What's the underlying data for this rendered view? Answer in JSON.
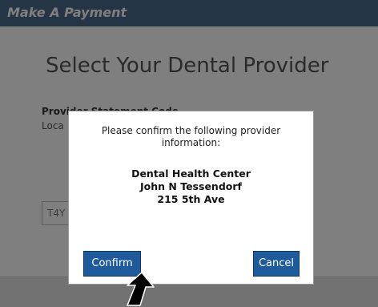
{
  "header": {
    "title": "Make A Payment"
  },
  "page": {
    "title": "Select Your Dental Provider",
    "statement_code_label": "Provider Statement Code",
    "statement_code_hint": "Loca",
    "input_value": "T4Y"
  },
  "modal": {
    "message": "Please confirm the following provider information:",
    "provider": {
      "name": "Dental Health Center",
      "doctor": "John N Tessendorf",
      "address": "215 5th Ave"
    },
    "confirm_label": "Confirm",
    "cancel_label": "Cancel"
  },
  "colors": {
    "header_bg": "#4a6a8a",
    "button_bg": "#1f5a9a",
    "overlay": "rgba(0,0,0,0.5)"
  },
  "icons": {
    "cursor": "arrow-pointer-icon"
  }
}
